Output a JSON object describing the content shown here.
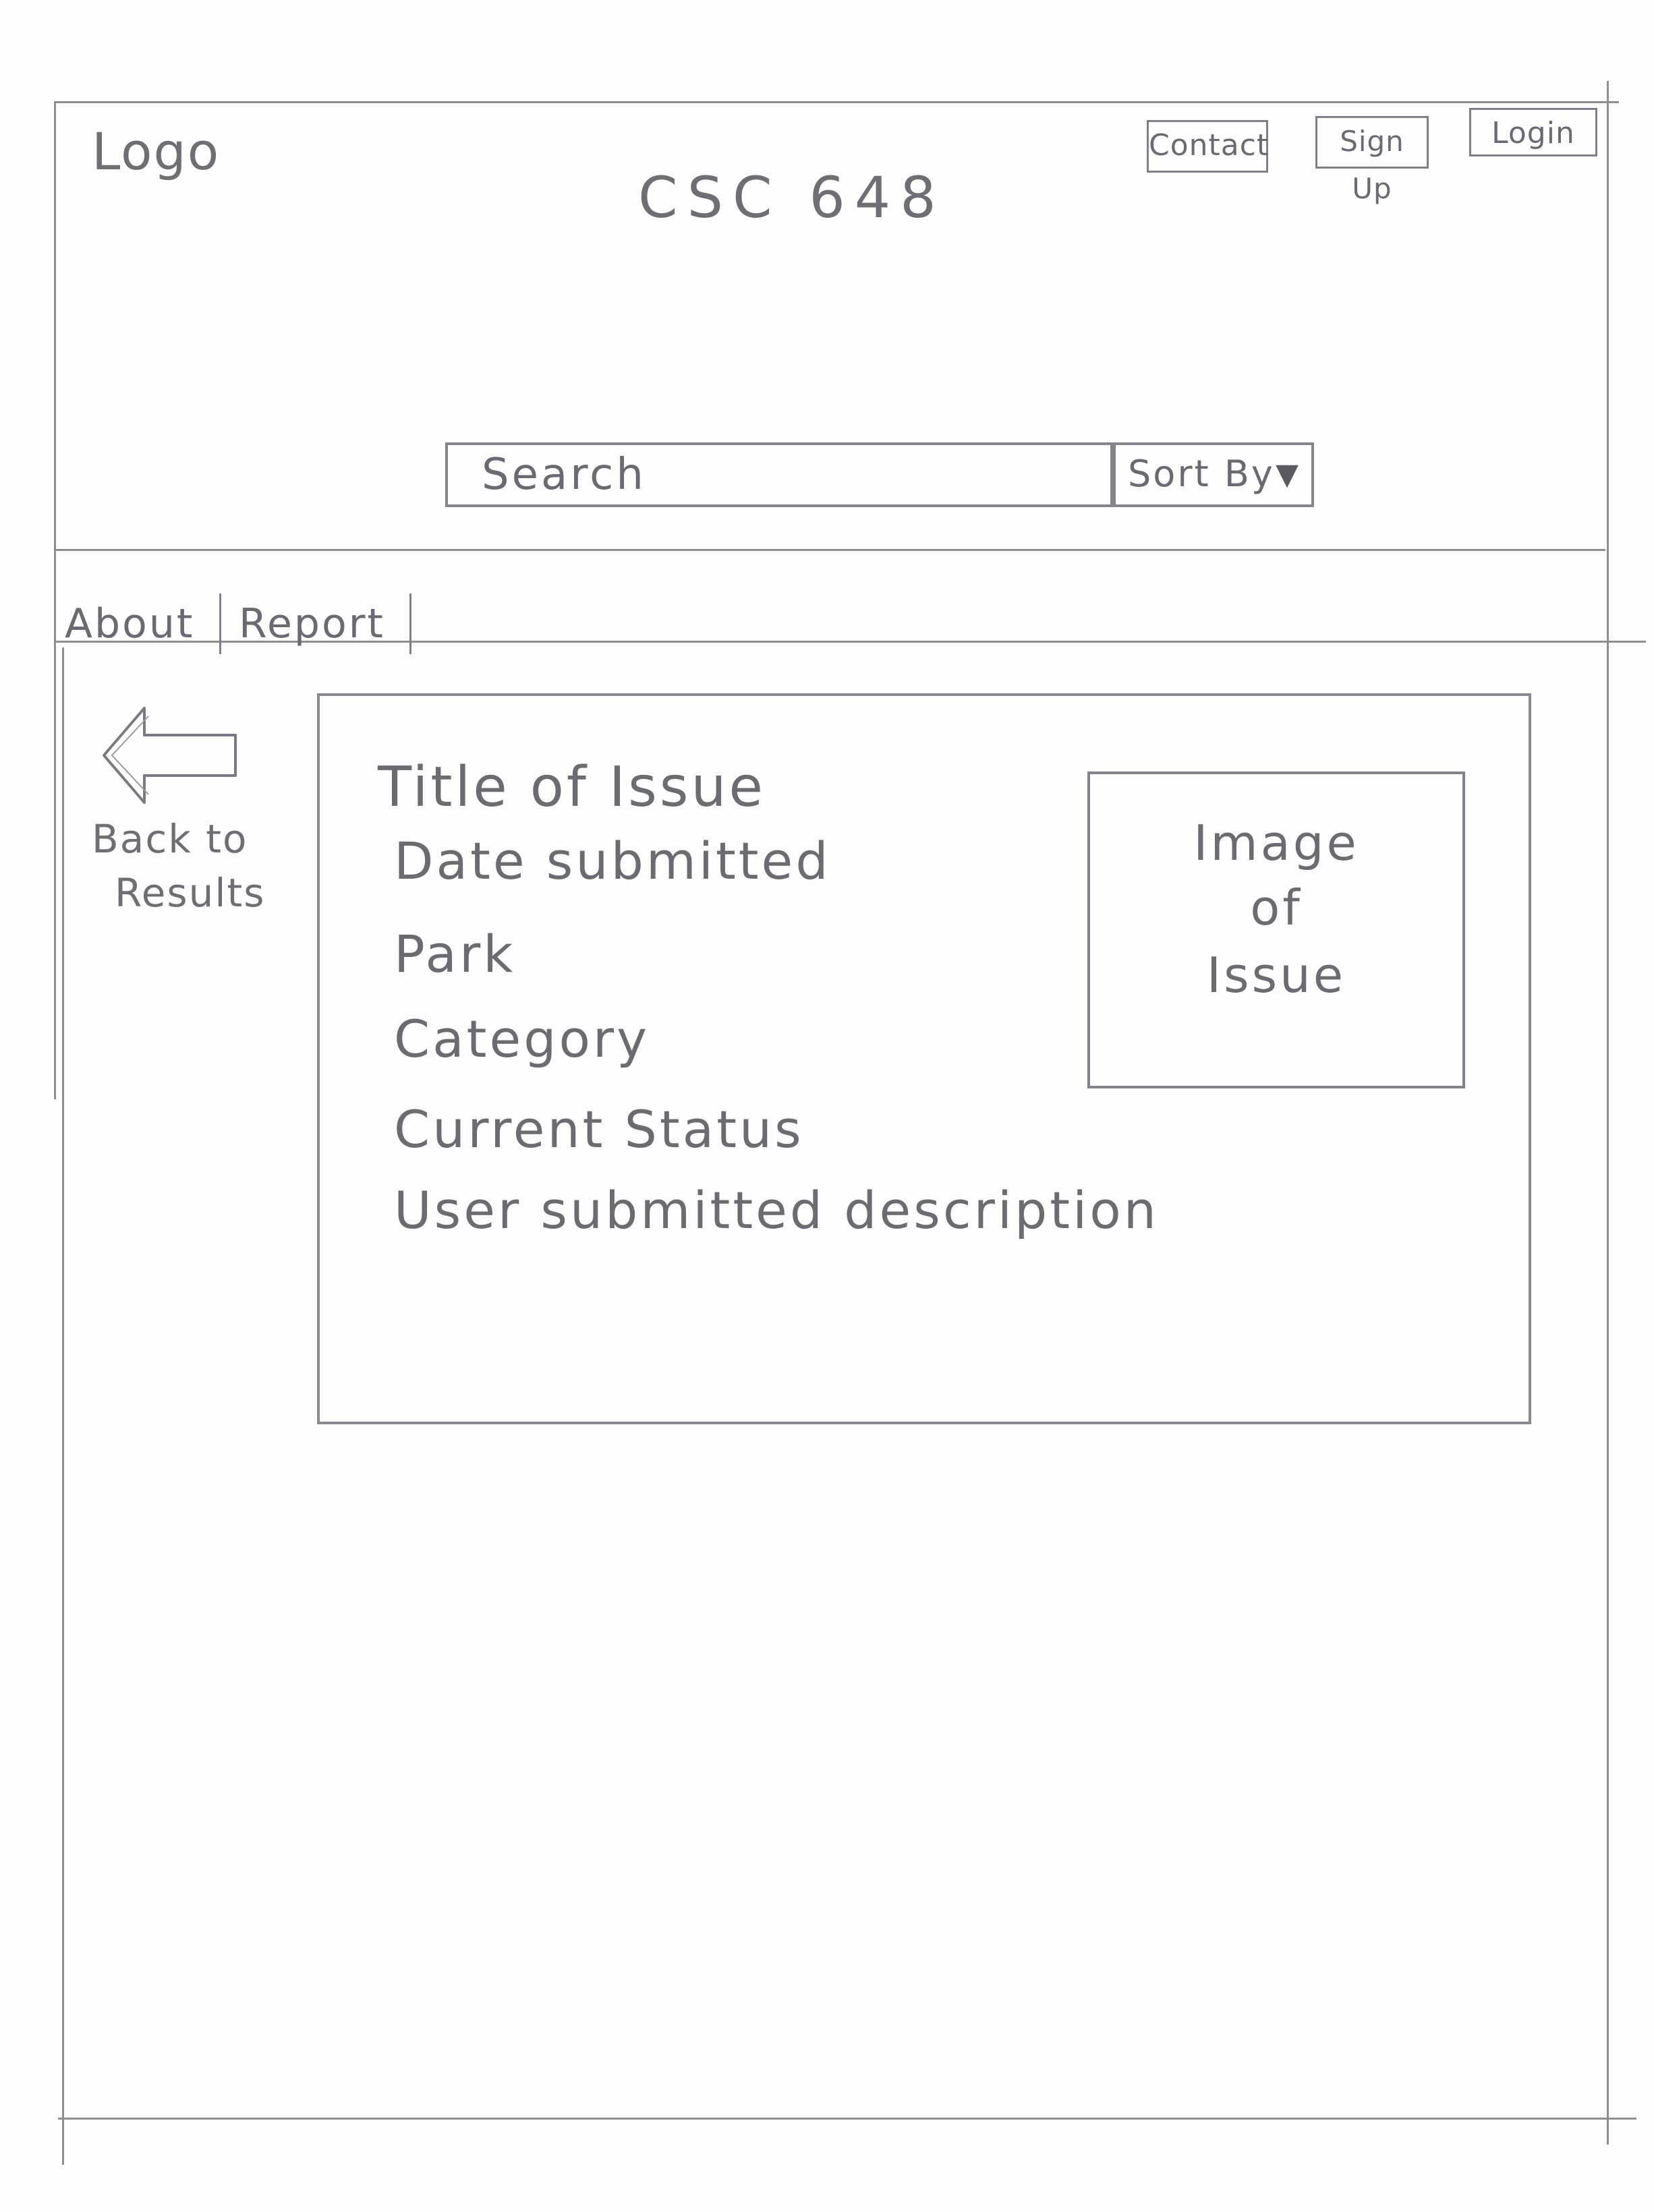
{
  "header": {
    "logo": "Logo",
    "title": "CSC 648",
    "nav": {
      "contact": "Contact",
      "signup": "Sign Up",
      "login": "Login"
    },
    "search": {
      "placeholder": "Search"
    },
    "sort": {
      "label": "Sort By"
    }
  },
  "tabs": {
    "about": "About",
    "report": "Report"
  },
  "back": {
    "line1": "Back to",
    "line2": "Results"
  },
  "issue": {
    "title": "Title of Issue",
    "date": "Date submitted",
    "park": "Park",
    "category": "Category",
    "status": "Current Status",
    "description": "User submitted description",
    "image": {
      "line1": "Image",
      "line2": "of",
      "line3": "Issue"
    }
  }
}
